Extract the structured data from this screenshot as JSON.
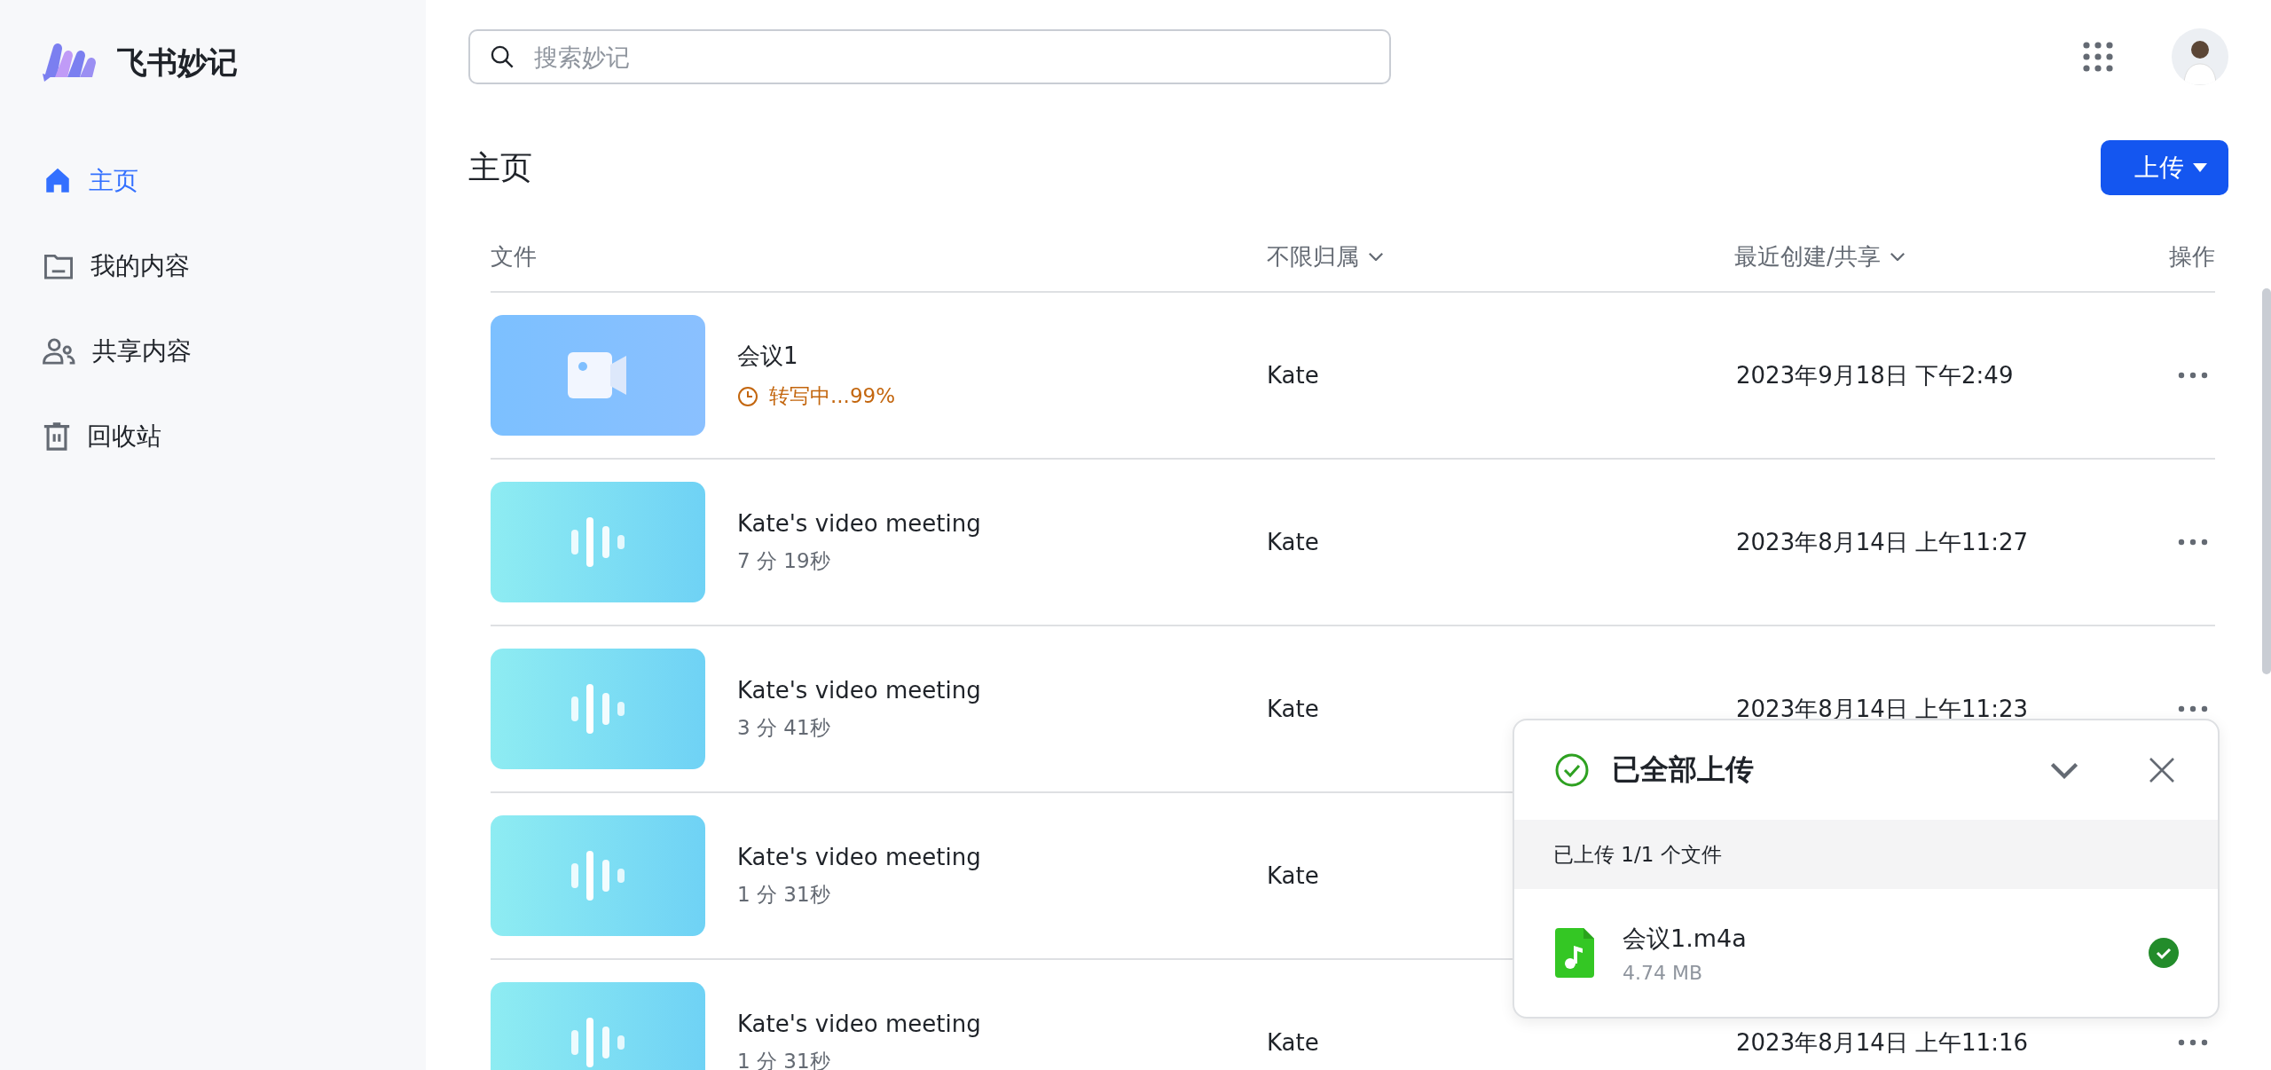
{
  "app": {
    "name": "飞书妙记"
  },
  "sidebar": {
    "items": [
      {
        "label": "主页",
        "kind": "home",
        "selected": true
      },
      {
        "label": "我的内容",
        "kind": "folder",
        "selected": false
      },
      {
        "label": "共享内容",
        "kind": "people",
        "selected": false
      },
      {
        "label": "回收站",
        "kind": "trash",
        "selected": false
      }
    ]
  },
  "search": {
    "placeholder": "搜索妙记"
  },
  "page": {
    "title": "主页",
    "upload_button": "上传"
  },
  "table": {
    "columns": [
      {
        "label": "文件",
        "dropdown": false
      },
      {
        "label": "不限归属",
        "dropdown": true
      },
      {
        "label": "最近创建/共享",
        "dropdown": true
      },
      {
        "label": "操作",
        "dropdown": false
      }
    ],
    "rows": [
      {
        "kind": "video",
        "name": "会议1",
        "status": {
          "kind": "progress",
          "text": "转写中...99%"
        },
        "owner": "Kate",
        "date": "2023年9月18日 下午2:49"
      },
      {
        "kind": "audio",
        "name": "Kate's video meeting",
        "status": {
          "kind": "duration",
          "text": "7 分 19秒"
        },
        "owner": "Kate",
        "date": "2023年8月14日 上午11:27"
      },
      {
        "kind": "audio",
        "name": "Kate's video meeting",
        "status": {
          "kind": "duration",
          "text": "3 分 41秒"
        },
        "owner": "Kate",
        "date": "2023年8月14日 上午11:23"
      },
      {
        "kind": "audio",
        "name": "Kate's video meeting",
        "status": {
          "kind": "duration",
          "text": "1 分 31秒"
        },
        "owner": "Kate"
      },
      {
        "kind": "audio",
        "name": "Kate's video meeting",
        "status": {
          "kind": "duration",
          "text": "1 分 31秒"
        },
        "owner": "Kate",
        "date": "2023年8月14日 上午11:16"
      }
    ]
  },
  "upload_panel": {
    "title": "已全部上传",
    "summary": "已上传 1/1 个文件",
    "files": [
      {
        "name": "会议1.m4a",
        "size": "4.74 MB",
        "done": true
      }
    ]
  }
}
